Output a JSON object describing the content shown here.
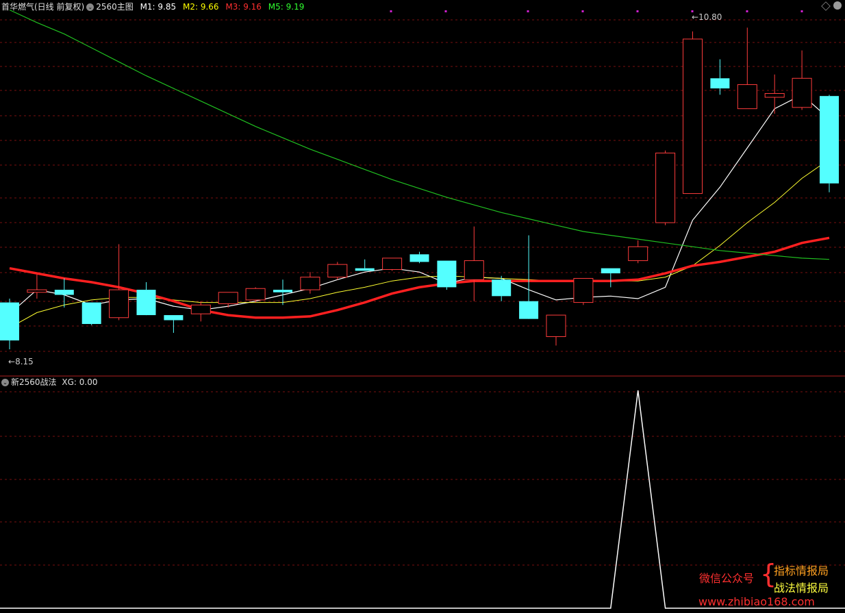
{
  "header": {
    "stock_name": "首华燃气(日线 前复权)",
    "main_indicator": "2560主图",
    "m1_label": "M1: 9.85",
    "m2_label": "M2: 9.66",
    "m3_label": "M3: 9.16",
    "m5_label": "M5: 9.19",
    "m1_color": "#ffffff",
    "m2_color": "#ffff00",
    "m3_color": "#ff3030",
    "m5_color": "#30ff30"
  },
  "sub_header": {
    "indicator_name": "新2560战法",
    "xg_label": "XG: 0.00"
  },
  "price_labels": {
    "high": "10.80",
    "low": "8.15"
  },
  "watermark": {
    "wechat": "微信公众号",
    "line1": "指标情报局",
    "line2": "战法情报局",
    "url": "www.zhibiao168.com"
  },
  "colors": {
    "up": "#ff3c3c",
    "down": "#54ffff",
    "grid": "#7a1010",
    "ma_white": "#ffffff",
    "ma_yellow": "#ffff30",
    "ma_red": "#ff2020",
    "ma_green": "#20c020",
    "xg_line": "#ffffff"
  },
  "chart_data": [
    {
      "type": "candlestick",
      "title": "2560主图",
      "candles": [
        {
          "o": 8.52,
          "h": 8.55,
          "l": 8.15,
          "c": 8.22
        },
        {
          "o": 8.6,
          "h": 8.74,
          "l": 8.55,
          "c": 8.62
        },
        {
          "o": 8.62,
          "h": 8.71,
          "l": 8.48,
          "c": 8.58
        },
        {
          "o": 8.52,
          "h": 8.52,
          "l": 8.34,
          "c": 8.35
        },
        {
          "o": 8.4,
          "h": 8.98,
          "l": 8.38,
          "c": 8.62
        },
        {
          "o": 8.62,
          "h": 8.68,
          "l": 8.43,
          "c": 8.42
        },
        {
          "o": 8.42,
          "h": 8.42,
          "l": 8.28,
          "c": 8.38
        },
        {
          "o": 8.43,
          "h": 8.53,
          "l": 8.37,
          "c": 8.5
        },
        {
          "o": 8.51,
          "h": 8.6,
          "l": 8.48,
          "c": 8.6
        },
        {
          "o": 8.54,
          "h": 8.64,
          "l": 8.52,
          "c": 8.63
        },
        {
          "o": 8.62,
          "h": 8.7,
          "l": 8.5,
          "c": 8.6
        },
        {
          "o": 8.62,
          "h": 8.76,
          "l": 8.59,
          "c": 8.72
        },
        {
          "o": 8.72,
          "h": 8.84,
          "l": 8.7,
          "c": 8.82
        },
        {
          "o": 8.79,
          "h": 8.86,
          "l": 8.77,
          "c": 8.77
        },
        {
          "o": 8.78,
          "h": 8.87,
          "l": 8.77,
          "c": 8.87
        },
        {
          "o": 8.9,
          "h": 8.92,
          "l": 8.83,
          "c": 8.84
        },
        {
          "o": 8.85,
          "h": 8.85,
          "l": 8.62,
          "c": 8.64
        },
        {
          "o": 8.7,
          "h": 9.12,
          "l": 8.53,
          "c": 8.85
        },
        {
          "o": 8.7,
          "h": 8.73,
          "l": 8.53,
          "c": 8.57
        },
        {
          "o": 8.53,
          "h": 9.05,
          "l": 8.4,
          "c": 8.39
        },
        {
          "o": 8.25,
          "h": 8.42,
          "l": 8.18,
          "c": 8.42
        },
        {
          "o": 8.52,
          "h": 8.71,
          "l": 8.5,
          "c": 8.71
        },
        {
          "o": 8.79,
          "h": 8.79,
          "l": 8.64,
          "c": 8.75
        },
        {
          "o": 8.85,
          "h": 9.01,
          "l": 8.83,
          "c": 8.96
        },
        {
          "o": 9.15,
          "h": 9.72,
          "l": 9.13,
          "c": 9.7
        },
        {
          "o": 9.38,
          "h": 10.66,
          "l": 9.51,
          "c": 10.6
        },
        {
          "o": 10.29,
          "h": 10.44,
          "l": 10.16,
          "c": 10.21
        },
        {
          "o": 10.05,
          "h": 10.69,
          "l": 10.06,
          "c": 10.24
        },
        {
          "o": 10.14,
          "h": 10.32,
          "l": 10.01,
          "c": 10.17
        },
        {
          "o": 10.06,
          "h": 10.51,
          "l": 10.04,
          "c": 10.29
        },
        {
          "o": 10.15,
          "h": 10.16,
          "l": 9.39,
          "c": 9.46
        }
      ],
      "series": [
        {
          "name": "M1",
          "values": [
            8.43,
            8.62,
            8.58,
            8.5,
            8.54,
            8.55,
            8.49,
            8.46,
            8.49,
            8.53,
            8.58,
            8.63,
            8.7,
            8.76,
            8.79,
            8.76,
            8.67,
            8.72,
            8.71,
            8.62,
            8.54,
            8.56,
            8.57,
            8.55,
            8.64,
            9.17,
            9.43,
            9.74,
            10.05,
            10.16,
            9.97
          ]
        },
        {
          "name": "M2",
          "values": [
            8.32,
            8.44,
            8.5,
            8.54,
            8.56,
            8.56,
            8.54,
            8.52,
            8.52,
            8.52,
            8.52,
            8.55,
            8.6,
            8.64,
            8.69,
            8.72,
            8.73,
            8.72,
            8.71,
            8.7,
            8.69,
            8.68,
            8.69,
            8.69,
            8.72,
            8.81,
            8.97,
            9.15,
            9.31,
            9.5,
            9.65
          ]
        },
        {
          "name": "M3",
          "values": [
            8.79,
            8.75,
            8.71,
            8.68,
            8.64,
            8.59,
            8.53,
            8.46,
            8.42,
            8.4,
            8.4,
            8.41,
            8.46,
            8.52,
            8.59,
            8.64,
            8.67,
            8.69,
            8.69,
            8.69,
            8.69,
            8.69,
            8.69,
            8.7,
            8.75,
            8.81,
            8.84,
            8.88,
            8.92,
            8.99,
            9.03
          ]
        },
        {
          "name": "M5",
          "values": [
            10.83,
            10.73,
            10.64,
            10.53,
            10.42,
            10.31,
            10.21,
            10.11,
            10.01,
            9.91,
            9.82,
            9.73,
            9.65,
            9.57,
            9.49,
            9.42,
            9.35,
            9.29,
            9.23,
            9.18,
            9.13,
            9.08,
            9.05,
            9.02,
            8.99,
            8.96,
            8.93,
            8.91,
            8.89,
            8.87,
            8.86
          ]
        }
      ]
    },
    {
      "type": "line",
      "title": "新2560战法",
      "series": [
        {
          "name": "XG",
          "values": [
            0,
            0,
            0,
            0,
            0,
            0,
            0,
            0,
            0,
            0,
            0,
            0,
            0,
            0,
            0,
            0,
            0,
            0,
            0,
            0,
            0,
            0,
            0,
            1,
            0,
            0,
            0,
            0,
            0,
            0,
            0
          ]
        }
      ]
    }
  ]
}
